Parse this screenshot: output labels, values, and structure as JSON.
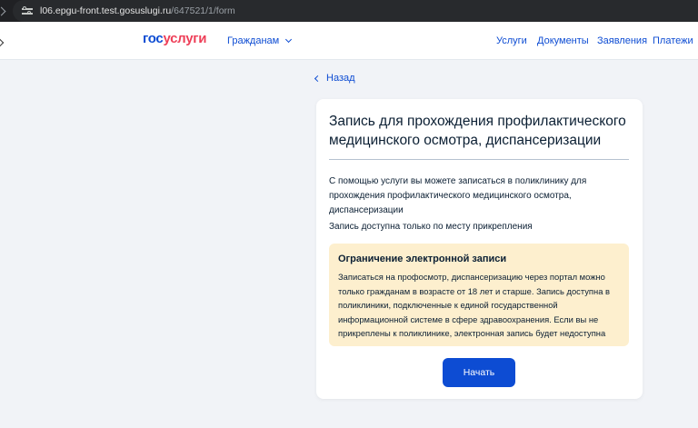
{
  "browser": {
    "url_host": "l06.epgu-front.test.gosuslugi.ru",
    "url_path": "/647521/1/form"
  },
  "header": {
    "logo_part1": "гос",
    "logo_part2": "услуги",
    "audience_label": "Гражданам",
    "nav": [
      "Услуги",
      "Документы",
      "Заявления",
      "Платежи"
    ]
  },
  "back_label": "Назад",
  "card": {
    "title": "Запись для прохождения профилактического медицинского осмотра, диспансеризации",
    "description": "С помощью услуги вы можете записаться в поликлинику для прохождения профилактического медицинского осмотра, диспансеризации",
    "note": "Запись доступна только по месту прикрепления",
    "warning": {
      "title": "Ограничение электронной записи",
      "text": "Записаться на профосмотр, диспансеризацию через портал можно только гражданам в возрасте от 18 лет и старше. Запись доступна в поликлиники, подключенные к единой государственной информационной системе в сфере здравоохранения. Если вы не прикреплены к поликлинике, электронная запись будет недоступна"
    },
    "start_button": "Начать"
  },
  "colors": {
    "accent": "#0d4cd3",
    "logo_red": "#ee3f58",
    "warning_bg": "#fdefce",
    "page_bg": "#f1f3f7"
  }
}
